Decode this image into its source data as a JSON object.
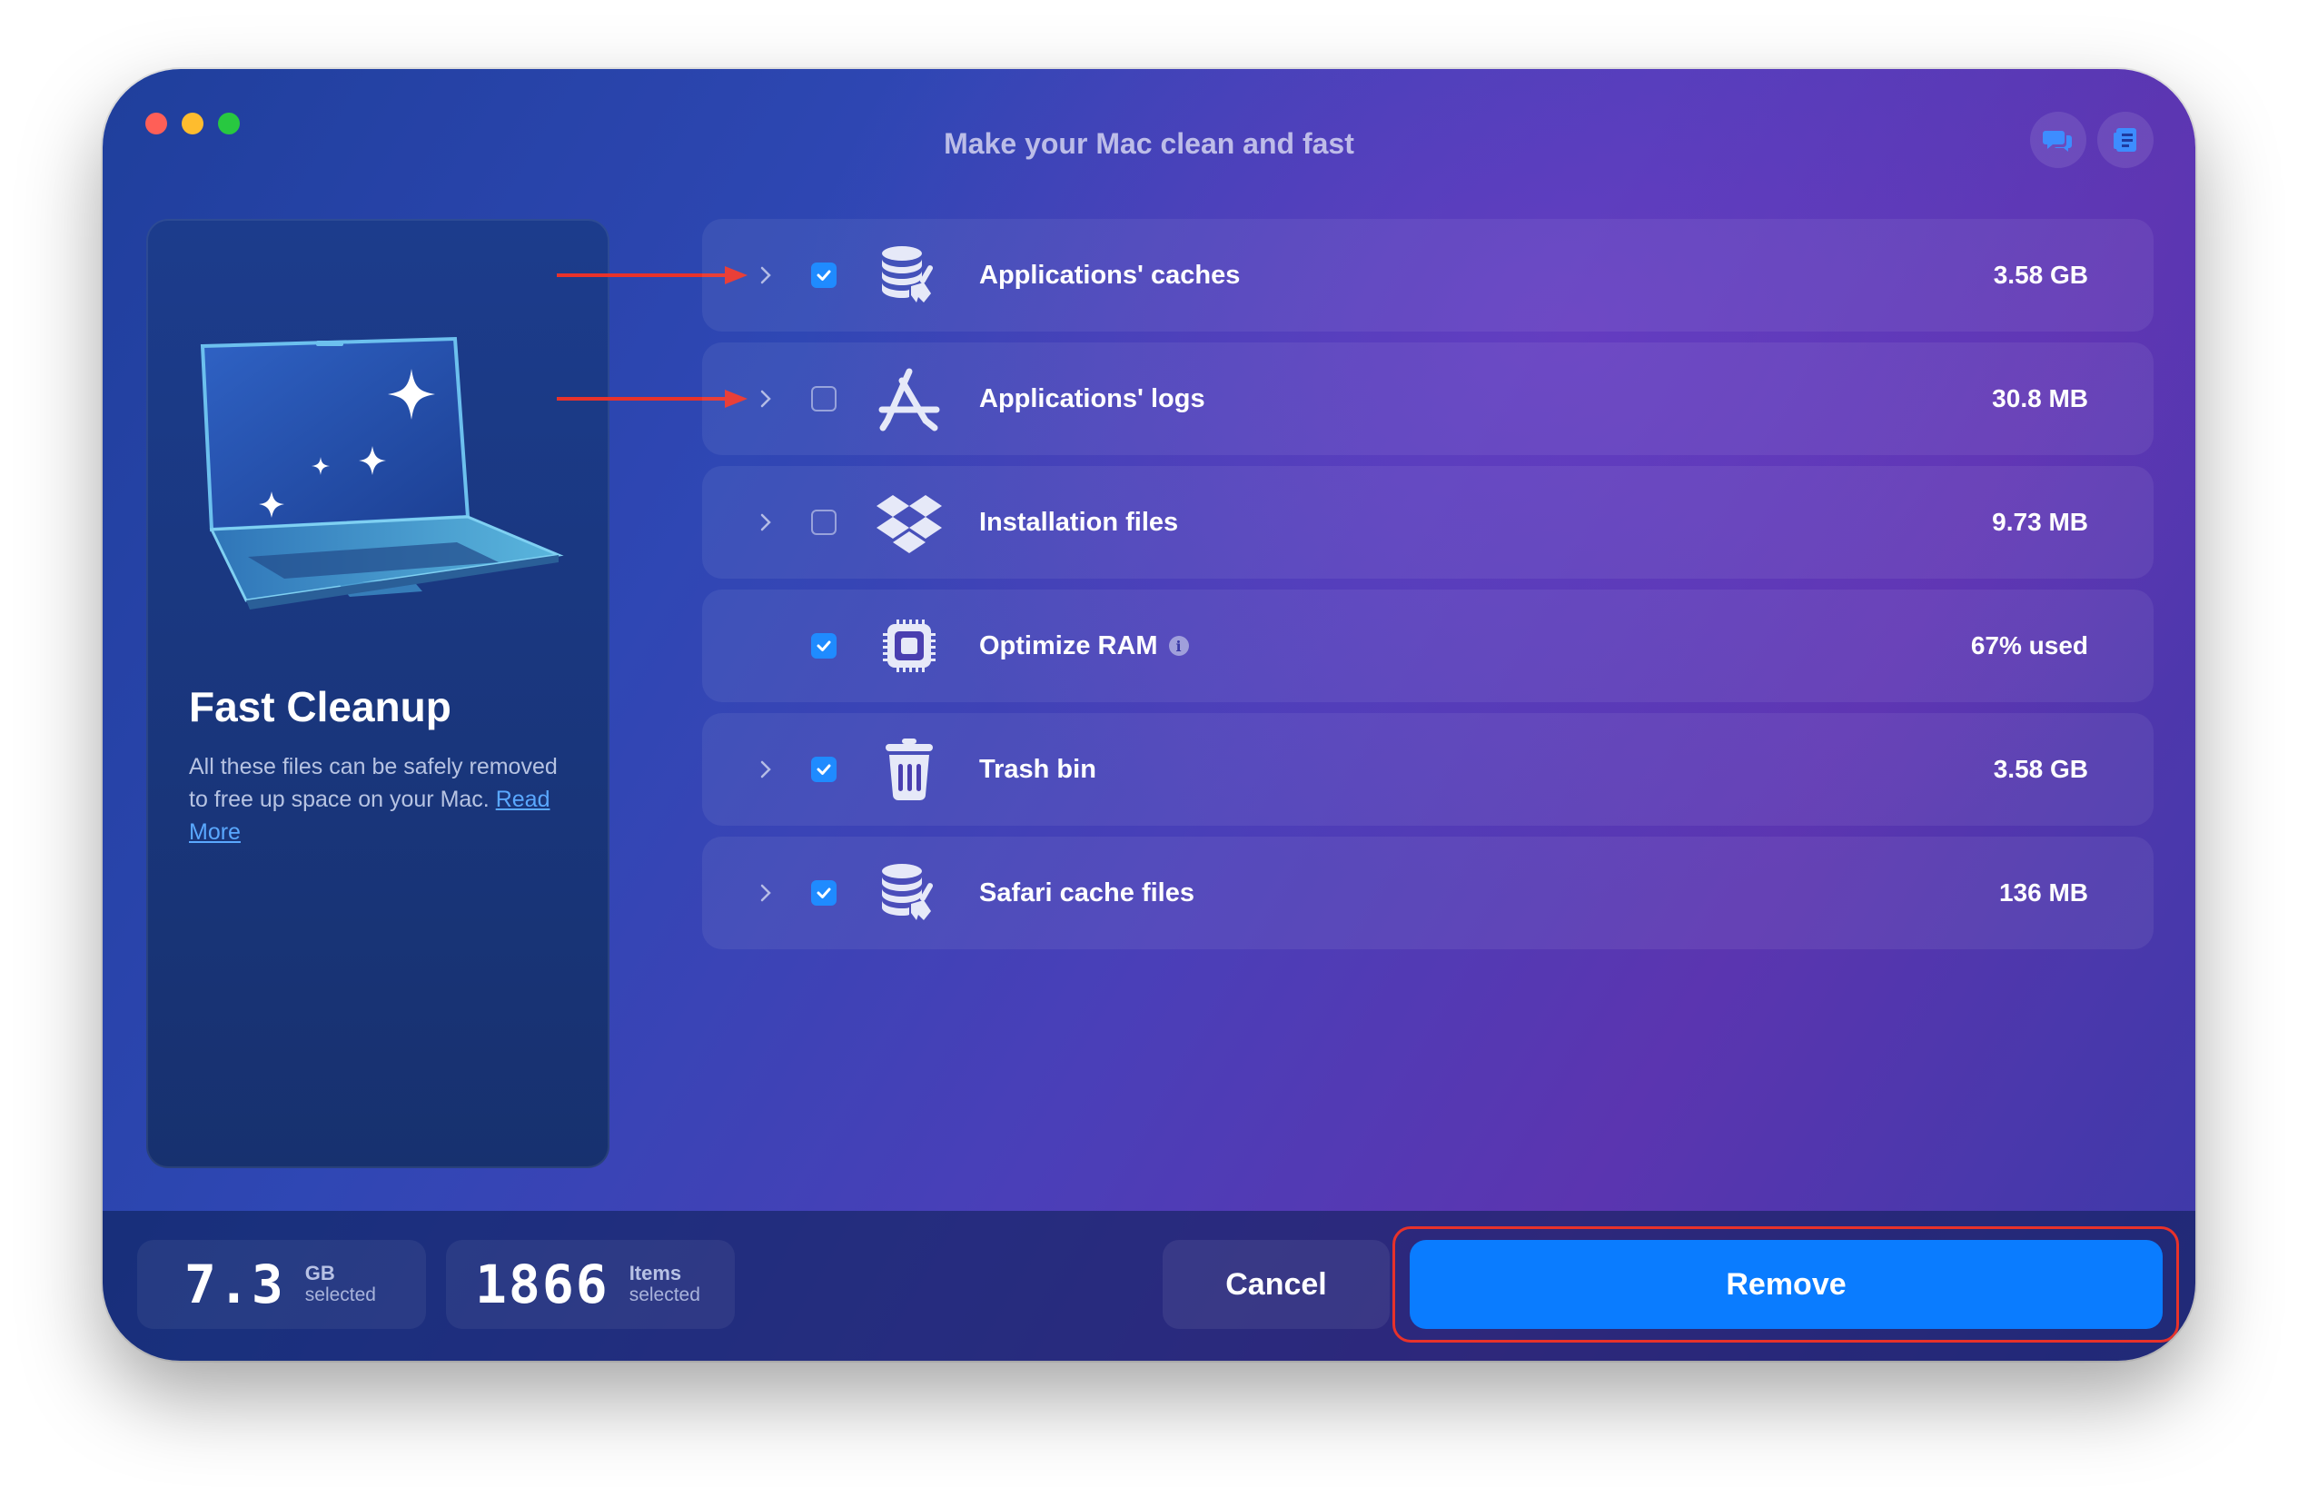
{
  "window": {
    "title": "Make your Mac clean and fast"
  },
  "toolbar": {
    "icons": [
      "chat-bubbles-icon",
      "document-list-icon"
    ]
  },
  "sidebar": {
    "title": "Fast Cleanup",
    "description": "All these files can be safely removed to free up space on your Mac.",
    "link_label": "Read More"
  },
  "items": [
    {
      "label": "Applications' caches",
      "value": "3.58 GB",
      "checked": true,
      "expandable": true,
      "icon": "database-broom-icon"
    },
    {
      "label": "Applications' logs",
      "value": "30.8 MB",
      "checked": false,
      "expandable": true,
      "icon": "app-store-icon"
    },
    {
      "label": "Installation files",
      "value": "9.73 MB",
      "checked": false,
      "expandable": true,
      "icon": "dropbox-boxes-icon"
    },
    {
      "label": "Optimize RAM",
      "value": "67% used",
      "checked": true,
      "expandable": false,
      "icon": "chip-icon"
    },
    {
      "label": "Trash bin",
      "value": "3.58 GB",
      "checked": true,
      "expandable": true,
      "icon": "trash-icon"
    },
    {
      "label": "Safari cache files",
      "value": "136 MB",
      "checked": true,
      "expandable": true,
      "icon": "database-broom-icon"
    }
  ],
  "footer": {
    "size_value": "7.3",
    "size_unit": "GB",
    "size_caption": "selected",
    "items_value": "1866",
    "items_unit": "Items",
    "items_caption": "selected",
    "cancel_label": "Cancel",
    "remove_label": "Remove"
  },
  "colors": {
    "accent": "#0a7cff",
    "annotation": "#e8322a"
  }
}
